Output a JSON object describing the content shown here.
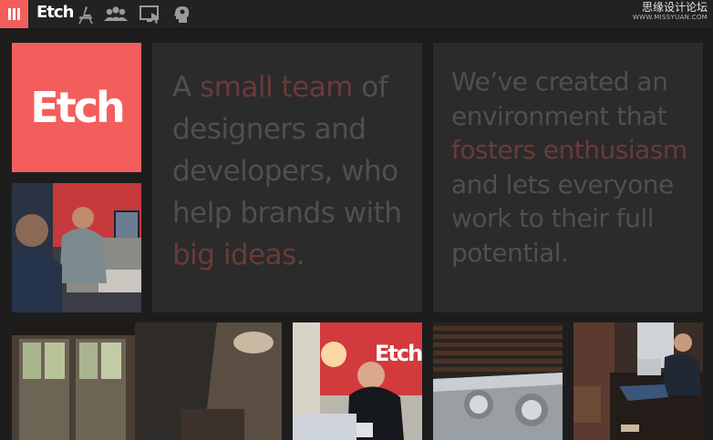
{
  "header": {
    "menu_icon": "hamburger-vertical-icon",
    "logo_text": "Etch",
    "nav_icons": [
      "chair-icon",
      "team-icon",
      "screen-icon",
      "head-icon"
    ],
    "watermark_line1": "思缘设计论坛",
    "watermark_line2": "WWW.MISSYUAN.COM"
  },
  "hero": {
    "logo_text": "Etch"
  },
  "panel_left": {
    "t1": "A ",
    "h1": "small team",
    "t2": " of designers and developers, who help brands with ",
    "h2": "big ideas",
    "t3": "."
  },
  "panel_right": {
    "t1": "We’ve created an environment that ",
    "h1": "fosters enthusiasm",
    "t2": " and lets everyone work to their full potential."
  },
  "photos": {
    "wall_sign": "Etch"
  },
  "colors": {
    "accent": "#f35e5c",
    "background": "#1d1d1d",
    "panel": "#2b2b2b",
    "text_muted": "#4f4f4f",
    "text_highlight": "#6b3a3a"
  }
}
